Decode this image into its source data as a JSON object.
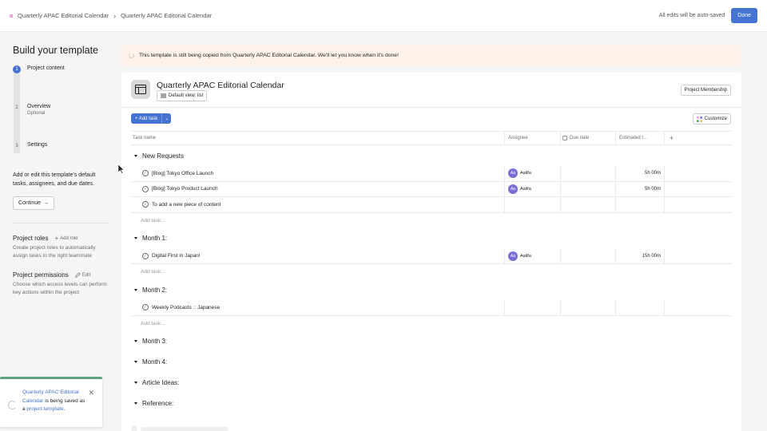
{
  "topbar": {
    "crumb1": "Quarterly APAC Editorial Calendar",
    "crumb2": "Quarterly APAC Editorial Calendar",
    "autosave": "All edits will be auto-saved",
    "done": "Done"
  },
  "sidebar": {
    "title": "Build your template",
    "steps": [
      {
        "num": "1",
        "label": "Project content",
        "sub": ""
      },
      {
        "num": "2",
        "label": "Overview",
        "sub": "Optional"
      },
      {
        "num": "3",
        "label": "Settings",
        "sub": ""
      }
    ],
    "description": "Add or edit this template's default tasks, assignees, and due dates.",
    "continue": "Continue",
    "roles_title": "Project roles",
    "roles_action": "Add role",
    "roles_desc": "Create project roles to automatically assign tasks to the right teammate",
    "perm_title": "Project permissions",
    "perm_action": "Edit",
    "perm_desc": "Choose which access levels can perform key actions within the project"
  },
  "banner": {
    "text": "This template is still being copied from Quarterly APAC Editorial Calendar. We'll let you know when it's done!"
  },
  "project": {
    "title": "Quarterly APAC Editorial Calendar",
    "default_view": "Default view: list",
    "membership": "Project Membership",
    "add_task": "Add task",
    "customize": "Customize"
  },
  "table": {
    "columns": {
      "name": "Task name",
      "assignee": "Assignee",
      "due": "Due date",
      "est": "Estimated t..."
    },
    "add_task_label": "Add task...",
    "sections": [
      {
        "name": "New Requests",
        "tasks": [
          {
            "name": "[Blog] Tokyo Office Launch",
            "avatar": "Aa",
            "assignee": "Aalifa",
            "est": "5h 00m"
          },
          {
            "name": "[Blog] Tokyo Product Launch",
            "avatar": "Aa",
            "assignee": "Aalifa",
            "est": "5h 00m"
          },
          {
            "name": "To add a new piece of content",
            "avatar": "",
            "assignee": "",
            "est": ""
          }
        ]
      },
      {
        "name": "Month 1:",
        "tasks": [
          {
            "name": "Digital First in Japan!",
            "avatar": "Aa",
            "assignee": "Aalifa",
            "est": "15h 00m"
          }
        ]
      },
      {
        "name": "Month 2:",
        "tasks": [
          {
            "name": "Weekly Podcasts :: Japanese",
            "avatar": "",
            "assignee": "",
            "est": ""
          }
        ]
      },
      {
        "name": "Month 3:",
        "tasks": null
      },
      {
        "name": "Month 4:",
        "tasks": null
      },
      {
        "name": "Article Ideas:",
        "tasks": null
      },
      {
        "name": "Reference:",
        "tasks": null
      }
    ]
  },
  "toast": {
    "link1": "Quarterly APAC Editorial Calendar",
    "text1": " is being saved as a ",
    "link2": "project template",
    "text2": "."
  },
  "colors": {
    "accent": "#4573d2",
    "banner_bg": "#fdf1ea",
    "toast_border": "#5da283",
    "avatar": "#7a6fd6"
  }
}
